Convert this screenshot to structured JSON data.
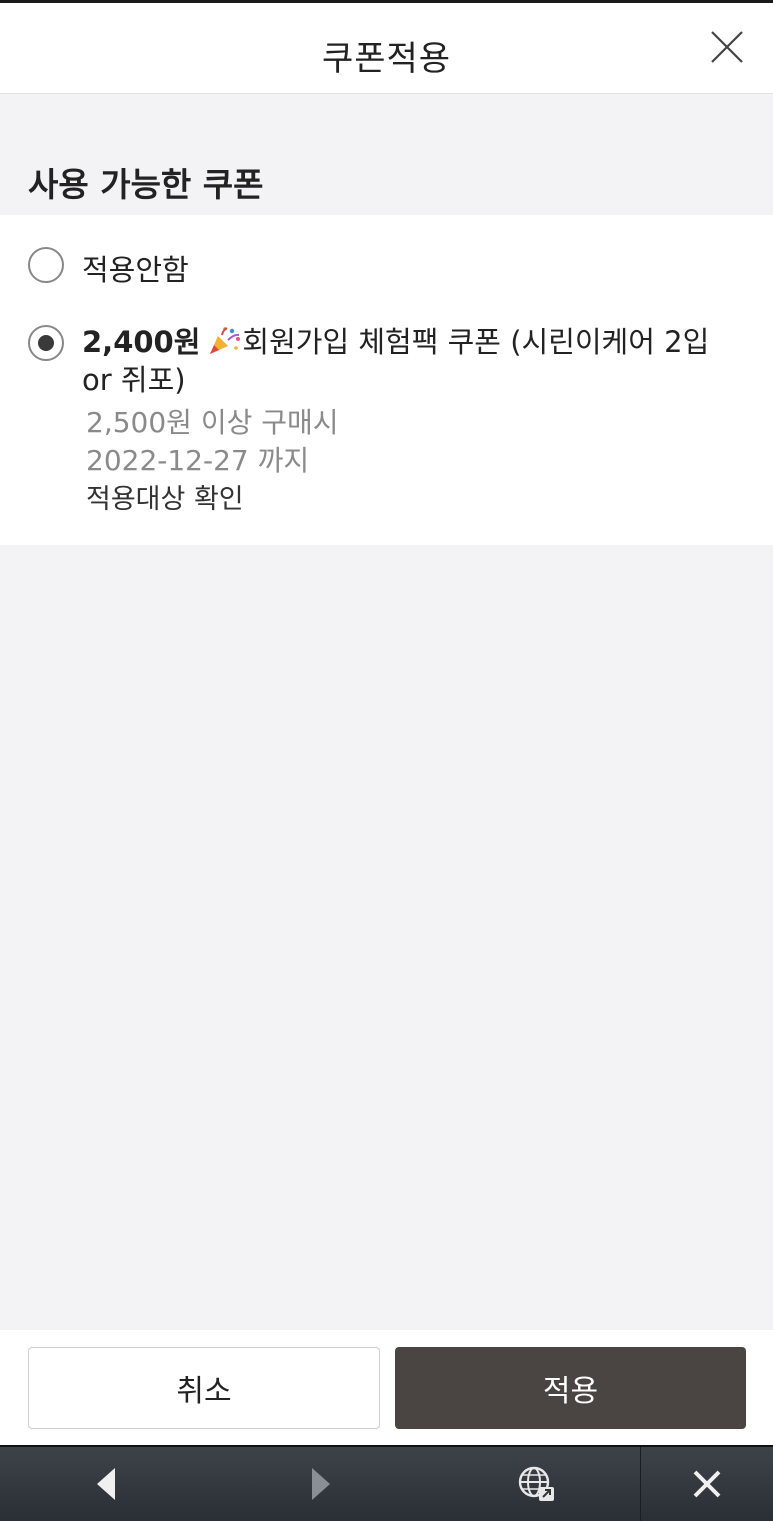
{
  "header": {
    "title": "쿠폰적용",
    "close_icon": "close-icon"
  },
  "section": {
    "title": "사용 가능한 쿠폰"
  },
  "options": {
    "none": {
      "label": "적용안함",
      "selected": false
    },
    "coupon": {
      "selected": true,
      "amount": "2,400원",
      "icon": "party-popper-icon",
      "name": "회원가입 체험팩 쿠폰 (시린이케어 2입 or 쥐포)",
      "min_purchase": "2,500원 이상 구매시",
      "expiry": "2022-12-27 까지",
      "check_target_label": "적용대상 확인"
    }
  },
  "footer": {
    "cancel_label": "취소",
    "apply_label": "적용"
  },
  "browser_nav": {
    "back_icon": "back-arrow-icon",
    "forward_icon": "forward-arrow-icon",
    "globe_icon": "globe-icon",
    "close_icon": "close-icon"
  },
  "colors": {
    "apply_button": "#4a4542",
    "page_background": "#f3f3f6",
    "nav_bar": "#33383e"
  }
}
